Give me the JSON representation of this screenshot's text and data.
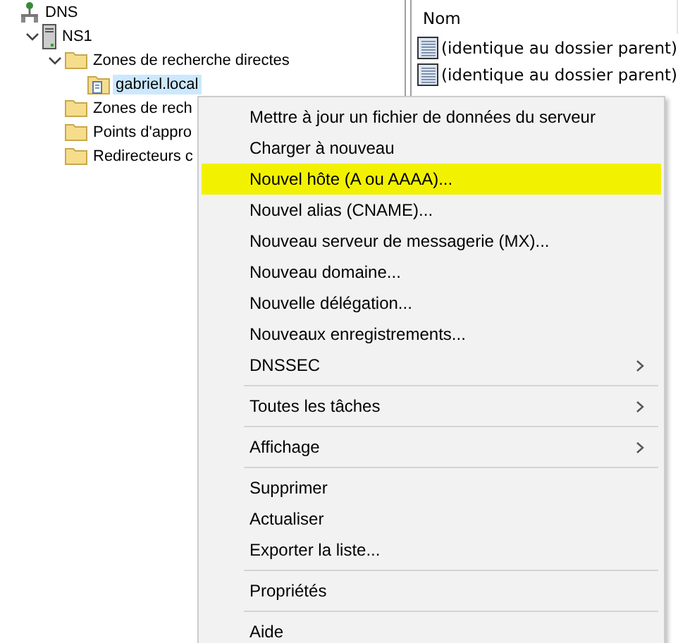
{
  "tree": [
    {
      "label": "DNS",
      "kind": "root",
      "selected": false,
      "children": [
        {
          "label": "NS1",
          "kind": "server",
          "expanded": true,
          "selected": false,
          "children": [
            {
              "label": "Zones de recherche directes",
              "kind": "folder",
              "expanded": true,
              "selected": false,
              "children": [
                {
                  "label": "gabriel.local",
                  "kind": "zone",
                  "selected": true
                }
              ]
            },
            {
              "label": "Zones de rech",
              "kind": "folder",
              "selected": false
            },
            {
              "label": "Points d'appro",
              "kind": "folder",
              "selected": false
            },
            {
              "label": "Redirecteurs c",
              "kind": "folder",
              "selected": false
            }
          ]
        }
      ]
    }
  ],
  "list": {
    "columns": [
      "Nom"
    ],
    "rows": [
      "(identique au dossier parent)",
      "(identique au dossier parent)"
    ]
  },
  "context_menu": [
    {
      "kind": "item",
      "label": "Mettre à jour un fichier de données du serveur",
      "submenu": false,
      "selected": false
    },
    {
      "kind": "item",
      "label": "Charger à nouveau",
      "submenu": false,
      "selected": false
    },
    {
      "kind": "item",
      "label": "Nouvel hôte (A ou AAAA)...",
      "submenu": false,
      "selected": true
    },
    {
      "kind": "item",
      "label": "Nouvel alias (CNAME)...",
      "submenu": false,
      "selected": false
    },
    {
      "kind": "item",
      "label": "Nouveau serveur de messagerie (MX)...",
      "submenu": false,
      "selected": false
    },
    {
      "kind": "item",
      "label": "Nouveau domaine...",
      "submenu": false,
      "selected": false
    },
    {
      "kind": "item",
      "label": "Nouvelle délégation...",
      "submenu": false,
      "selected": false
    },
    {
      "kind": "item",
      "label": "Nouveaux enregistrements...",
      "submenu": false,
      "selected": false
    },
    {
      "kind": "item",
      "label": "DNSSEC",
      "submenu": true,
      "selected": false
    },
    {
      "kind": "separator"
    },
    {
      "kind": "item",
      "label": "Toutes les tâches",
      "submenu": true,
      "selected": false
    },
    {
      "kind": "separator"
    },
    {
      "kind": "item",
      "label": "Affichage",
      "submenu": true,
      "selected": false
    },
    {
      "kind": "separator"
    },
    {
      "kind": "item",
      "label": "Supprimer",
      "submenu": false,
      "selected": false
    },
    {
      "kind": "item",
      "label": "Actualiser",
      "submenu": false,
      "selected": false
    },
    {
      "kind": "item",
      "label": "Exporter la liste...",
      "submenu": false,
      "selected": false
    },
    {
      "kind": "separator"
    },
    {
      "kind": "item",
      "label": "Propriétés",
      "submenu": false,
      "selected": false
    },
    {
      "kind": "separator"
    },
    {
      "kind": "item",
      "label": "Aide",
      "submenu": false,
      "selected": false
    }
  ]
}
